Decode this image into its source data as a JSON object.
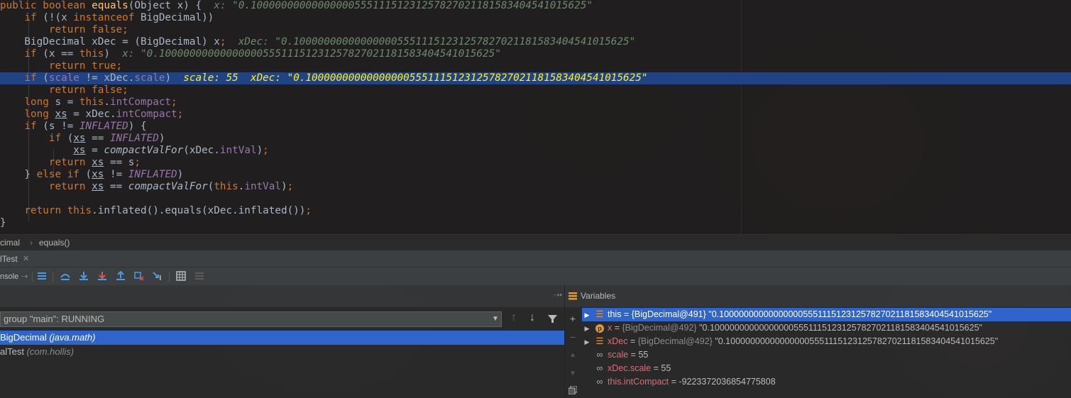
{
  "editor": {
    "inline_x": "x: \"0.1000000000000000055511151231257827021181583404541015625\"",
    "inline_xdec": "xDec: \"0.1000000000000000055511151231257827021181583404541015625\"",
    "inline_scale": "scale: 55",
    "inline_xdec_hl": "xDec: \"0.1000000000000000055511151231257827021181583404541015625\""
  },
  "breadcrumb": {
    "item1": "cimal",
    "item2": "equals()"
  },
  "run_tab": {
    "label": "lTest"
  },
  "toolbar": {
    "console_label": "nsole"
  },
  "frames": {
    "thread_label": "group \"main\": RUNNING",
    "rows": [
      {
        "method": "BigDecimal",
        "pkg": "(java.math)"
      },
      {
        "method": "alTest",
        "pkg": "(com.hollis)"
      }
    ]
  },
  "variables": {
    "title": "Variables",
    "rows": [
      {
        "name": "this",
        "eq": " = ",
        "type": "{BigDecimal@491}",
        "value": " \"0.1000000000000000055511151231257827021181583404541015625\""
      },
      {
        "name": "x",
        "eq": " = ",
        "type": "{BigDecimal@492}",
        "value": " \"0.1000000000000000055511151231257827021181583404541015625\""
      },
      {
        "name": "xDec",
        "eq": " = ",
        "type": "{BigDecimal@492}",
        "value": " \"0.1000000000000000055511151231257827021181583404541015625\""
      },
      {
        "name": "scale",
        "eq": " = ",
        "type": "",
        "value": "55"
      },
      {
        "name": "xDec.scale",
        "eq": " = ",
        "type": "",
        "value": "55"
      },
      {
        "name": "this.intCompact",
        "eq": " = ",
        "type": "",
        "value": "-9223372036854775808"
      }
    ]
  },
  "colors": {
    "selection": "#2f65ca",
    "debug_line": "#214283",
    "keyword": "#cc7832",
    "inline_value": "#ffef28"
  }
}
